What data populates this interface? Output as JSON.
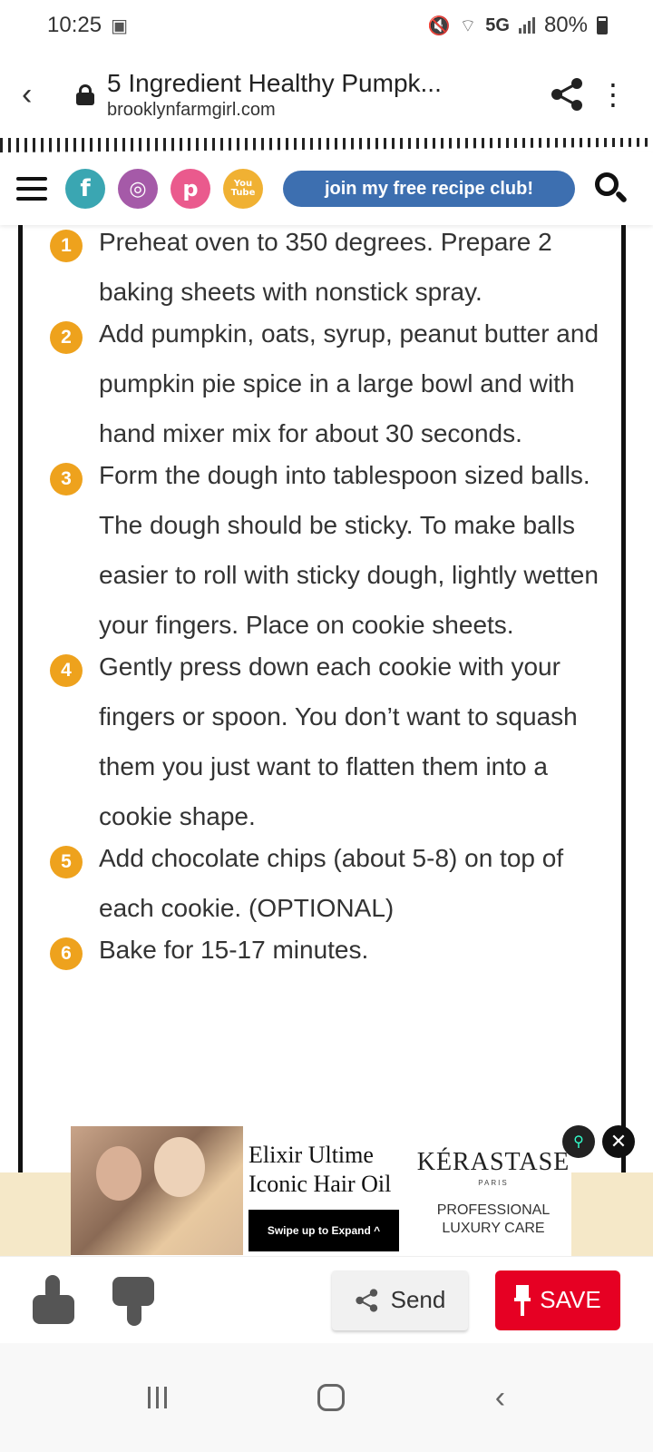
{
  "status": {
    "time": "10:25",
    "network": "5G",
    "battery": "80%",
    "icons": [
      "notification-icon",
      "mute-icon",
      "wifi-icon",
      "signal-icon",
      "battery-icon"
    ]
  },
  "browser": {
    "page_title": "5 Ingredient Healthy Pumpk...",
    "domain": "brooklynfarmgirl.com"
  },
  "site_header": {
    "social": [
      {
        "name": "facebook",
        "glyph": "f"
      },
      {
        "name": "instagram",
        "glyph": "◎"
      },
      {
        "name": "pinterest",
        "glyph": "p"
      },
      {
        "name": "youtube",
        "glyph": "You Tube"
      }
    ],
    "club_button": "join my free recipe club!"
  },
  "steps": [
    {
      "num": "1",
      "text": "Preheat oven to 350 degrees. Prepare 2 baking sheets with nonstick spray."
    },
    {
      "num": "2",
      "text": "Add pumpkin, oats, syrup, peanut butter and pumpkin pie spice in a large bowl and with hand mixer mix for about 30 seconds."
    },
    {
      "num": "3",
      "text": "Form the dough into tablespoon sized balls. The dough should be sticky. To make balls easier to roll with sticky dough, lightly wetten your fingers. Place on cookie sheets."
    },
    {
      "num": "4",
      "text": "Gently press down each cookie with your fingers or spoon. You don’t want to squash them you just want to flatten them into a cookie shape."
    },
    {
      "num": "5",
      "text": "Add chocolate chips (about 5-8) on top of each cookie. (OPTIONAL)"
    },
    {
      "num": "6",
      "text": "Bake for 15-17 minutes."
    }
  ],
  "ad": {
    "headline_line1": "Elixir Ultime",
    "headline_line2": "Iconic Hair Oil",
    "swipe": "Swipe up to Expand ^",
    "brand": "KÉRASTASE",
    "brand_sub": "PARIS",
    "tagline_line1": "PROFESSIONAL",
    "tagline_line2": "LUXURY CARE"
  },
  "actions": {
    "send": "Send",
    "save": "SAVE"
  },
  "colors": {
    "step_badge": "#eea21d",
    "club_button": "#3d6fb0",
    "save_button": "#e60023"
  }
}
